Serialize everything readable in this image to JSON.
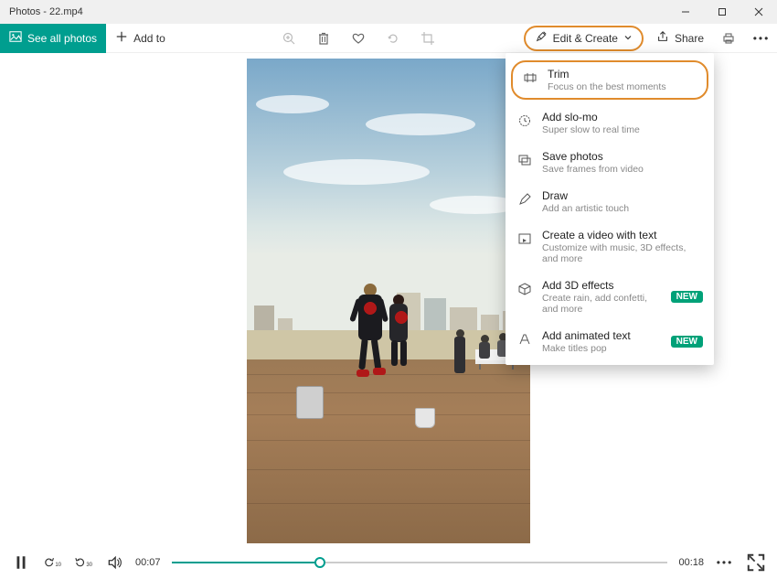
{
  "window": {
    "title": "Photos - 22.mp4"
  },
  "toolbar": {
    "see_all": "See all photos",
    "add_to": "Add to",
    "edit_create": "Edit & Create",
    "share": "Share"
  },
  "menu": {
    "items": [
      {
        "title": "Trim",
        "sub": "Focus on the best moments"
      },
      {
        "title": "Add slo-mo",
        "sub": "Super slow to real time"
      },
      {
        "title": "Save photos",
        "sub": "Save frames from video"
      },
      {
        "title": "Draw",
        "sub": "Add an artistic touch"
      },
      {
        "title": "Create a video with text",
        "sub": "Customize with music, 3D effects, and more"
      },
      {
        "title": "Add 3D effects",
        "sub": "Create rain, add confetti, and more",
        "badge": "NEW"
      },
      {
        "title": "Add animated text",
        "sub": "Make titles pop",
        "badge": "NEW"
      }
    ]
  },
  "playback": {
    "elapsed": "00:07",
    "duration": "00:18",
    "progress_pct": 30,
    "skip_back_label": "10",
    "skip_fwd_label": "30"
  }
}
